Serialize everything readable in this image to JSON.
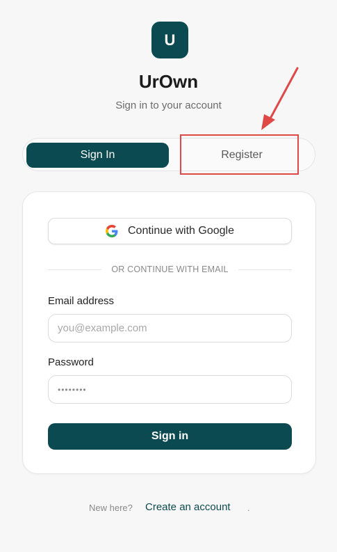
{
  "brand": {
    "logo_letter": "U",
    "title": "UrOwn",
    "subtitle": "Sign in to your account",
    "color": "#0b4a50"
  },
  "tabs": [
    {
      "label": "Sign In",
      "active": true
    },
    {
      "label": "Register",
      "active": false
    }
  ],
  "annotation": {
    "color": "#e04848",
    "target": "Register"
  },
  "auth": {
    "google_button_label": "Continue with Google",
    "google_icon": "google-g-icon",
    "divider_text": "OR CONTINUE WITH EMAIL",
    "email": {
      "label": "Email address",
      "placeholder": "you@example.com",
      "value": ""
    },
    "password": {
      "label": "Password",
      "placeholder": "••••••••",
      "value": ""
    },
    "submit_label": "Sign in"
  },
  "footer": {
    "prompt": "New here?",
    "link_label": "Create an account",
    "trailing": "."
  }
}
